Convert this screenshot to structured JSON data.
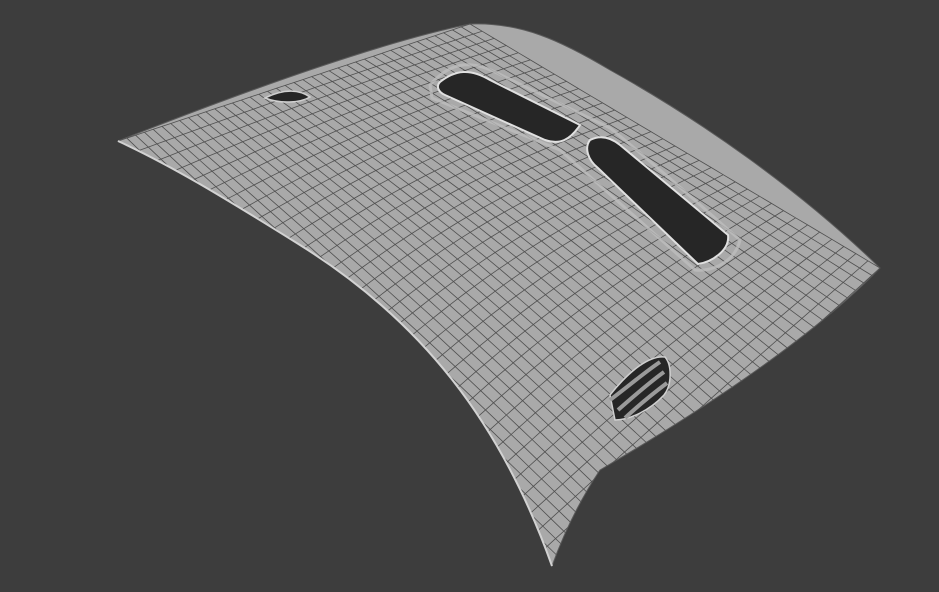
{
  "viewport": {
    "background_color": "#3d3d3d",
    "object": {
      "kind": "car-hood-mesh",
      "display_mode": "wireframe-on-solid",
      "surface_color": "#a9a9a9",
      "wire_color": "#505050",
      "opening_color": "#262626"
    }
  }
}
